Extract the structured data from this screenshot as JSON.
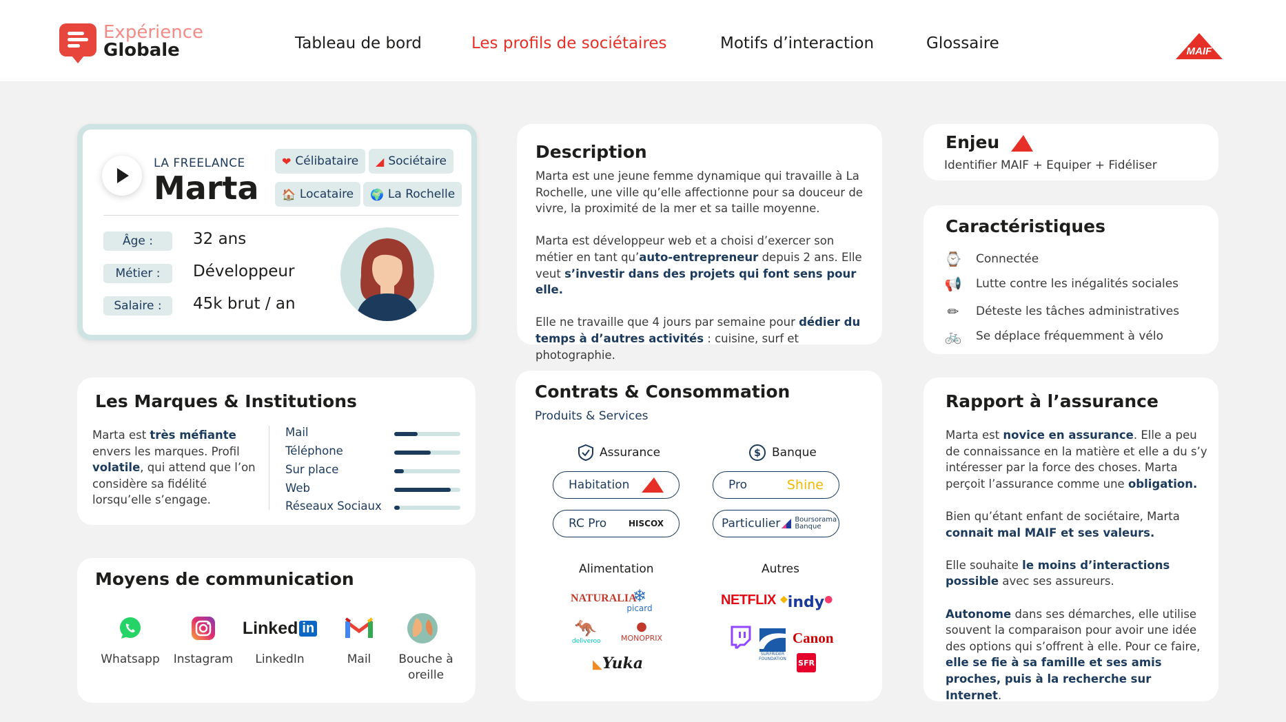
{
  "header": {
    "logo_line1": "Expérience",
    "logo_line2": "Globale",
    "nav": [
      "Tableau de bord",
      "Les profils de sociétaires",
      "Motifs d’interaction",
      "Glossaire"
    ],
    "maif_logo_text": "MAIF"
  },
  "profile": {
    "role": "LA FREELANCE",
    "name": "Marta",
    "tags": [
      "Célibataire",
      "Sociétaire",
      "Locataire",
      "La Rochelle"
    ],
    "fields": [
      {
        "label": "Âge :",
        "value": "32 ans"
      },
      {
        "label": "Métier :",
        "value": "Développeur"
      },
      {
        "label": "Salaire :",
        "value": "45k brut / an"
      }
    ]
  },
  "description": {
    "title": "Description",
    "p1": "Marta est une jeune femme dynamique qui travaille à La Rochelle, une ville qu’elle affectionne pour sa douceur de vivre, la proximité de la mer et sa taille moyenne.",
    "p2_a": "Marta est développeur web et a choisi d’exercer son métier en tant qu’",
    "p2_b": "auto-entrepreneur",
    "p2_c": " depuis 2 ans. Elle veut ",
    "p2_d": "s’investir dans des projets qui font sens pour elle.",
    "p3_a": "Elle ne travaille que 4 jours par semaine pour ",
    "p3_b": "dédier du temps à d’autres activités",
    "p3_c": " : cuisine, surf et photographie."
  },
  "enjeu": {
    "title": "Enjeu",
    "text": "Identifier MAIF + Equiper + Fidéliser"
  },
  "caracteristiques": {
    "title": "Caractéristiques",
    "items": [
      {
        "icon": "watch-icon",
        "text": "Connectée"
      },
      {
        "icon": "megaphone-icon",
        "text": "Lutte contre les inégalités sociales"
      },
      {
        "icon": "pencil-icon",
        "text": "Déteste les tâches administratives"
      },
      {
        "icon": "bicycle-icon",
        "text": "Se déplace fréquemment à vélo"
      }
    ]
  },
  "marques": {
    "title": "Les Marques & Institutions",
    "t_a": "Marta est ",
    "t_b": "très méfiante",
    "t_c": " envers les marques. Profil ",
    "t_d": "volatile",
    "t_e": ", qui attend que l’on considère sa fidélité lorsqu’elle s’engage.",
    "channels": [
      {
        "label": "Mail",
        "level": 0.35
      },
      {
        "label": "Téléphone",
        "level": 0.55
      },
      {
        "label": "Sur place",
        "level": 0.15
      },
      {
        "label": "Web",
        "level": 0.85
      },
      {
        "label": "Réseaux Sociaux",
        "level": 0.08
      }
    ],
    "bar_track_color": "#cfe3e3",
    "bar_fill_color": "#1b3a5c"
  },
  "moyens": {
    "title": "Moyens de communication",
    "items": [
      {
        "icon": "whatsapp-icon",
        "label": "Whatsapp"
      },
      {
        "icon": "instagram-icon",
        "label": "Instagram"
      },
      {
        "icon": "linkedin-icon",
        "label": "LinkedIn"
      },
      {
        "icon": "gmail-icon",
        "label": "Mail"
      },
      {
        "icon": "word-of-mouth-icon",
        "label": "Bouche à oreille"
      }
    ],
    "linkedin_wordmark": "Linked",
    "linkedin_in": "in"
  },
  "contrats": {
    "title": "Contrats & Consommation",
    "subtitle": "Produits & Services",
    "assurance_label": "Assurance",
    "banque_label": "Banque",
    "assurance": [
      {
        "label": "Habitation",
        "brand": "MAIF"
      },
      {
        "label": "RC Pro",
        "brand": "HISCOX"
      }
    ],
    "banque": [
      {
        "label": "Pro",
        "brand": "Shine"
      },
      {
        "label": "Particulier",
        "brand_line1": "Boursorama",
        "brand_line2": "Banque"
      }
    ],
    "alimentation_label": "Alimentation",
    "autres_label": "Autres",
    "alimentation_brands": [
      "NATURALIA",
      "picard",
      "deliveroo",
      "MONOPRIX",
      "Yuka"
    ],
    "autres_brands": [
      "NETFLIX",
      "indy",
      "Canon",
      "SURFRIDER FOUNDATION",
      "SFR"
    ]
  },
  "rapport": {
    "title": "Rapport à l’assurance",
    "p1_a": "Marta est ",
    "p1_b": "novice en assurance",
    "p1_c": ". Elle a peu de connaissance en la matière et elle a du s’y intéresser par la force des choses. Marta perçoit l’assurance comme une ",
    "p1_d": "obligation.",
    "p2_a": "Bien qu’étant enfant de sociétaire, Marta ",
    "p2_b": "connait mal MAIF et ses valeurs.",
    "p3_a": "Elle souhaite ",
    "p3_b": "le moins d’interactions possible",
    "p3_c": " avec ses assureurs.",
    "p4_a": "Autonome",
    "p4_b": " dans ses démarches, elle utilise souvent la comparaison pour avoir une idée des options qui s’offrent à elle. Pour ce faire, ",
    "p4_c": "elle se fie à sa famille et ses amis proches, puis à la recherche sur Internet",
    "p4_d": "."
  },
  "colors": {
    "accent_red": "#e63027",
    "navy": "#1b3a5c",
    "teal_light": "#cfe3e3",
    "background": "#f2f2f2"
  }
}
